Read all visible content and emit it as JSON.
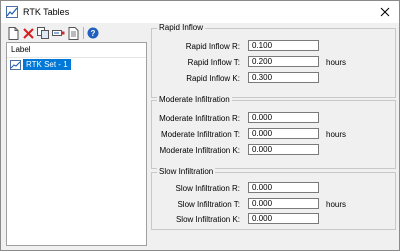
{
  "window": {
    "title": "RTK Tables"
  },
  "toolbar": {
    "buttons": [
      {
        "name": "new",
        "icon": "new-document-icon"
      },
      {
        "name": "delete",
        "icon": "delete-x-icon"
      },
      {
        "name": "copy",
        "icon": "copy-icon"
      },
      {
        "name": "rename",
        "icon": "rename-icon"
      },
      {
        "name": "notes",
        "icon": "notes-icon"
      },
      {
        "name": "help",
        "icon": "help-icon"
      }
    ]
  },
  "list": {
    "header": "Label",
    "items": [
      {
        "label": "RTK Set - 1",
        "selected": true
      }
    ]
  },
  "groups": {
    "rapid": {
      "title": "Rapid Inflow",
      "r_label": "Rapid Inflow R:",
      "r_value": "0.100",
      "t_label": "Rapid Inflow T:",
      "t_value": "0.200",
      "t_unit": "hours",
      "k_label": "Rapid Inflow K:",
      "k_value": "0.300"
    },
    "moderate": {
      "title": "Moderate Infiltration",
      "r_label": "Moderate Infiltration R:",
      "r_value": "0.000",
      "t_label": "Moderate Infiltration T:",
      "t_value": "0.000",
      "t_unit": "hours",
      "k_label": "Moderate Infiltration K:",
      "k_value": "0.000"
    },
    "slow": {
      "title": "Slow Infiltration",
      "r_label": "Slow Infiltration R:",
      "r_value": "0.000",
      "t_label": "Slow Infiltration T:",
      "t_value": "0.000",
      "t_unit": "hours",
      "k_label": "Slow Infiltration K:",
      "k_value": "0.000"
    }
  },
  "colors": {
    "selection": "#0078d7",
    "delete": "#d42020",
    "help": "#1f5fbf"
  }
}
